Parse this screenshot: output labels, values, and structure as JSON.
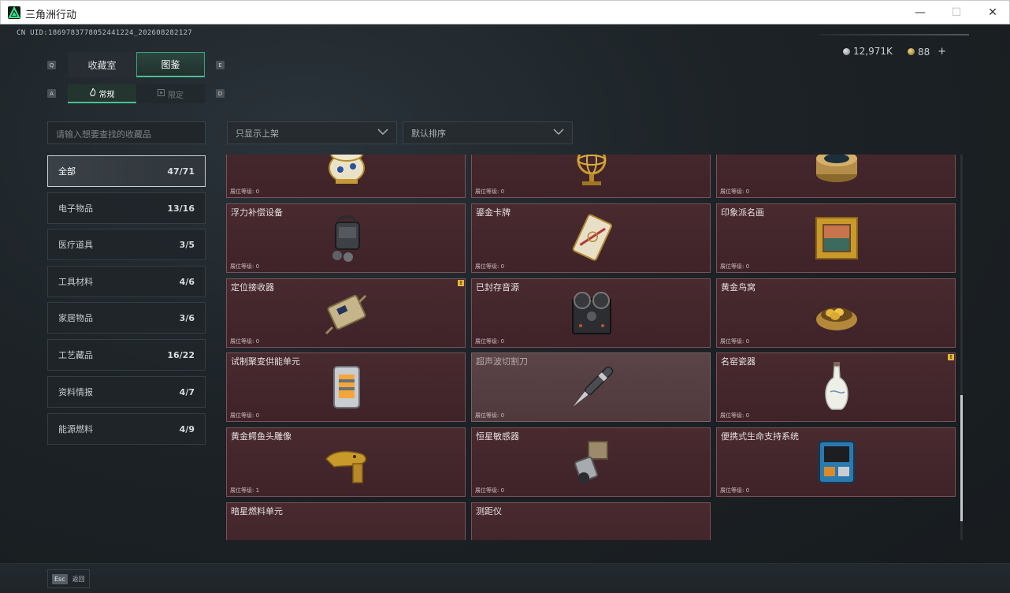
{
  "window": {
    "title": "三角洲行动",
    "controls": {
      "minimize": "—",
      "maximize": "☐",
      "close": "✕"
    }
  },
  "header": {
    "uid": "CN UID:1869783778052441224_202608282127",
    "currency": {
      "silver": "12,971K",
      "gold": "88",
      "add": "+"
    }
  },
  "tabs": {
    "key_left": "Q",
    "key_right": "E",
    "main": [
      {
        "label": "收藏室"
      },
      {
        "label": "图鉴"
      }
    ],
    "sub_key_left": "A",
    "sub_key_right": "D",
    "sub": [
      {
        "label": "常规"
      },
      {
        "label": "限定"
      }
    ]
  },
  "search": {
    "placeholder": "请输入想要查找的收藏品"
  },
  "filters": {
    "shelf": "只显示上架",
    "sort": "默认排序"
  },
  "categories": [
    {
      "label": "全部",
      "count": "47/71"
    },
    {
      "label": "电子物品",
      "count": "13/16"
    },
    {
      "label": "医疗道具",
      "count": "3/5"
    },
    {
      "label": "工具材料",
      "count": "4/6"
    },
    {
      "label": "家居物品",
      "count": "3/6"
    },
    {
      "label": "工艺藏品",
      "count": "16/22"
    },
    {
      "label": "资料情报",
      "count": "4/7"
    },
    {
      "label": "能源燃料",
      "count": "4/9"
    }
  ],
  "items": [
    {
      "name": "",
      "level": "展位等级: 0",
      "icon": "faberge-egg-icon"
    },
    {
      "name": "",
      "level": "展位等级: 0",
      "icon": "armillary-sphere-icon"
    },
    {
      "name": "",
      "level": "展位等级: 0",
      "icon": "caviar-tin-icon"
    },
    {
      "name": "浮力补偿设备",
      "level": "展位等级: 0",
      "icon": "buoyancy-device-icon"
    },
    {
      "name": "鎏金卡牌",
      "level": "展位等级: 0",
      "icon": "gilded-card-icon"
    },
    {
      "name": "印象派名画",
      "level": "展位等级: 0",
      "icon": "painting-icon"
    },
    {
      "name": "定位接收器",
      "level": "展位等级: 0",
      "icon": "gps-receiver-icon",
      "warn": "!"
    },
    {
      "name": "已封存音源",
      "level": "展位等级: 0",
      "icon": "reel-recorder-icon"
    },
    {
      "name": "黄金鸟窝",
      "level": "展位等级: 0",
      "icon": "golden-nest-icon"
    },
    {
      "name": "试制聚变供能单元",
      "level": "展位等级: 0",
      "icon": "fusion-unit-icon"
    },
    {
      "name": "超声波切割刀",
      "level": "展位等级: 0",
      "icon": "ultrasonic-knife-icon",
      "dim": true
    },
    {
      "name": "名窑瓷器",
      "level": "展位等级: 0",
      "icon": "porcelain-vase-icon",
      "warn": "!"
    },
    {
      "name": "黄金鳄鱼头雕像",
      "level": "展位等级: 1",
      "icon": "gold-crocodile-icon"
    },
    {
      "name": "恒星敏感器",
      "level": "展位等级: 0",
      "icon": "star-sensor-icon"
    },
    {
      "name": "便携式生命支持系统",
      "level": "展位等级: 0",
      "icon": "life-support-icon"
    },
    {
      "name": "暗星燃料单元",
      "level": "",
      "icon": "fuel-cell-icon"
    },
    {
      "name": "测距仪",
      "level": "",
      "icon": "rangefinder-icon"
    }
  ],
  "footer": {
    "esc_key": "Esc",
    "esc_label": "返回"
  }
}
